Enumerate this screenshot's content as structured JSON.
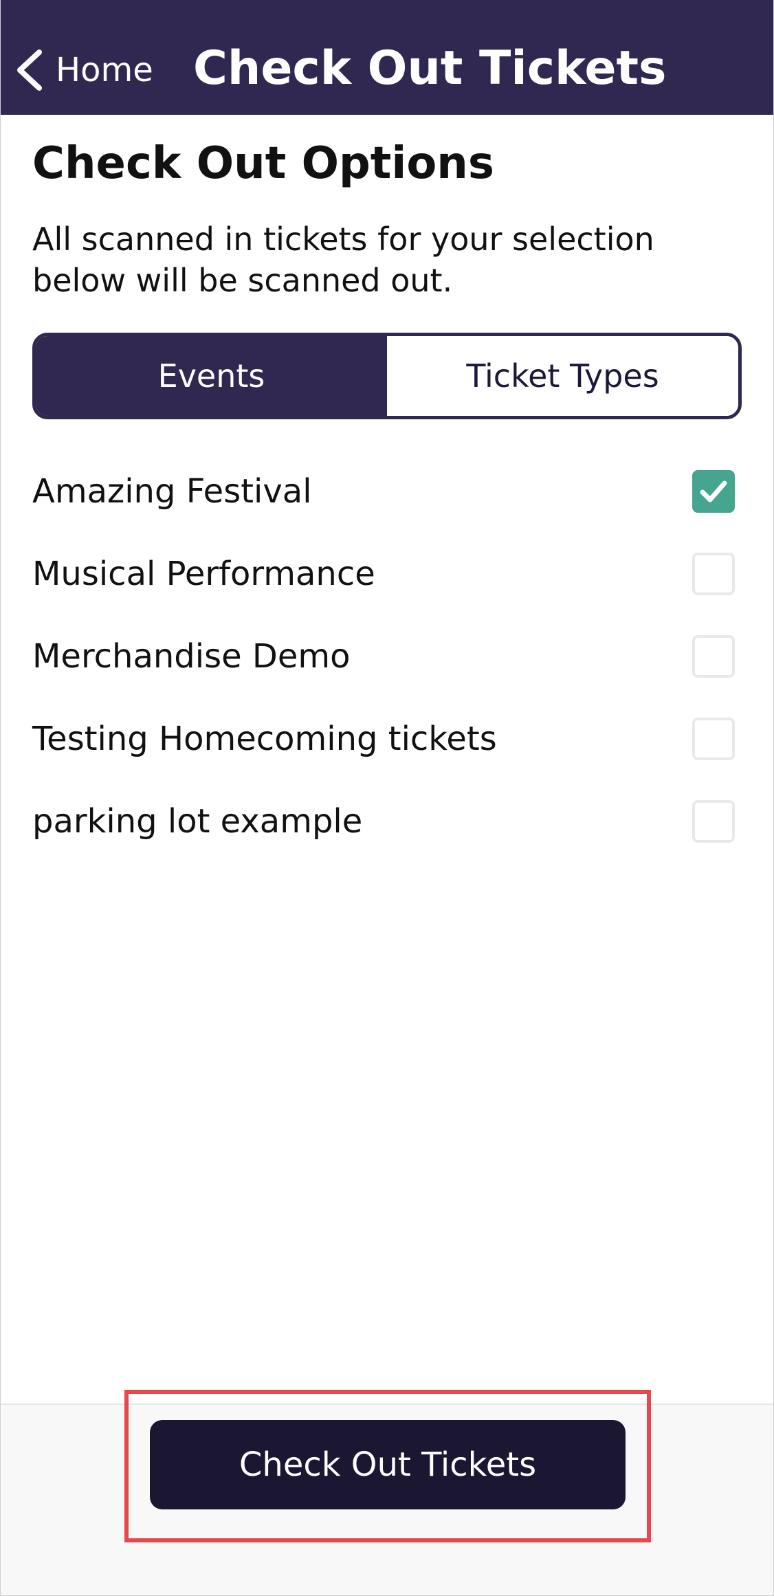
{
  "header": {
    "back_label": "Home",
    "title": "Check Out Tickets"
  },
  "content": {
    "title": "Check Out Options",
    "description": "All scanned in tickets for your selection below will be scanned out."
  },
  "segmented": {
    "selected": "Events",
    "options": [
      "Events",
      "Ticket Types"
    ]
  },
  "events": [
    {
      "label": "Amazing Festival",
      "checked": true
    },
    {
      "label": "Musical Performance",
      "checked": false
    },
    {
      "label": "Merchandise Demo",
      "checked": false
    },
    {
      "label": "Testing Homecoming tickets",
      "checked": false
    },
    {
      "label": "parking lot example",
      "checked": false
    }
  ],
  "footer": {
    "button_label": "Check Out Tickets"
  },
  "colors": {
    "header_bg": "#302850",
    "checkbox_checked": "#46a58e",
    "button_bg": "#1b1631",
    "highlight": "#e8474d"
  },
  "icons": {
    "back": "chevron-left-icon",
    "check": "checkmark-icon"
  }
}
